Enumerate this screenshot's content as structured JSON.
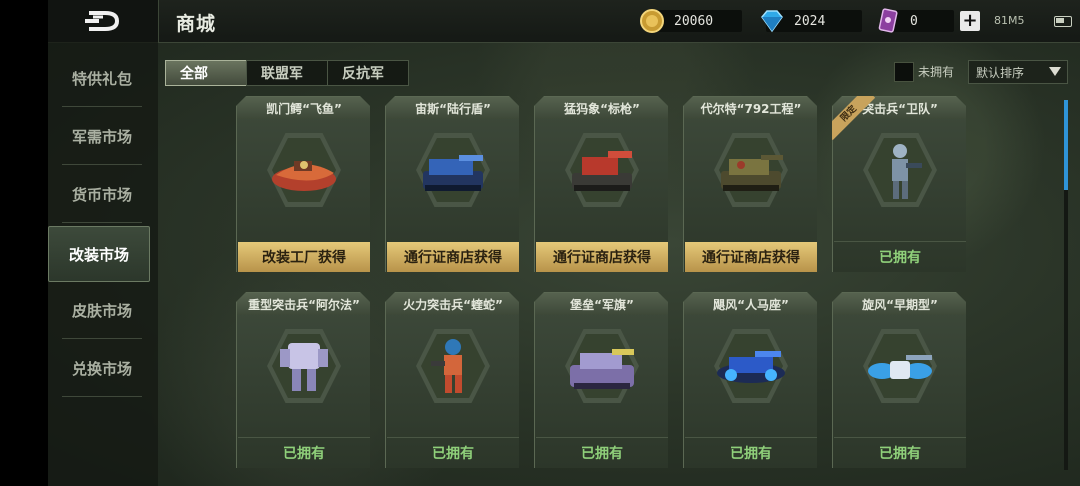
{
  "header": {
    "title": "商城"
  },
  "resources": [
    {
      "name": "gold-coin",
      "value": "20060"
    },
    {
      "name": "diamond",
      "value": "2024"
    },
    {
      "name": "ticket-card",
      "value": "0"
    }
  ],
  "status": {
    "text": "81M5"
  },
  "sidebar": {
    "items": [
      {
        "label": "特供礼包"
      },
      {
        "label": "军需市场"
      },
      {
        "label": "货币市场"
      },
      {
        "label": "改装市场"
      },
      {
        "label": "皮肤市场"
      },
      {
        "label": "兑换市场"
      }
    ],
    "active_index": 3
  },
  "tabs": [
    {
      "label": "全部"
    },
    {
      "label": "联盟军"
    },
    {
      "label": "反抗军"
    }
  ],
  "filter": {
    "owned_label": "未拥有",
    "sort_value": "默认排序"
  },
  "cards": [
    {
      "name": "凯门鳄“飞鱼”",
      "action": "改装工厂获得",
      "style": "gold",
      "unit": "boat"
    },
    {
      "name": "宙斯“陆行盾”",
      "action": "通行证商店获得",
      "style": "gold",
      "unit": "tank-blue"
    },
    {
      "name": "猛犸象“标枪”",
      "action": "通行证商店获得",
      "style": "gold",
      "unit": "tank-red"
    },
    {
      "name": "代尔特“792工程”",
      "action": "通行证商店获得",
      "style": "gold",
      "unit": "tank-camo"
    },
    {
      "name": "突击兵“卫队”",
      "action": "已拥有",
      "style": "owned",
      "unit": "soldier",
      "ribbon": "限定"
    },
    {
      "name": "重型突击兵“阿尔法”",
      "action": "已拥有",
      "style": "owned",
      "unit": "mech"
    },
    {
      "name": "火力突击兵“蝰蛇”",
      "action": "已拥有",
      "style": "owned",
      "unit": "trooper"
    },
    {
      "name": "堡垒“军旗”",
      "action": "已拥有",
      "style": "owned",
      "unit": "fortress"
    },
    {
      "name": "飓风“人马座”",
      "action": "已拥有",
      "style": "owned",
      "unit": "hover"
    },
    {
      "name": "旋风“早期型”",
      "action": "已拥有",
      "style": "owned",
      "unit": "drone"
    }
  ],
  "colors": {
    "accent": "#2f94d8",
    "gold": "#e5c979",
    "owned": "#8fd07a"
  }
}
